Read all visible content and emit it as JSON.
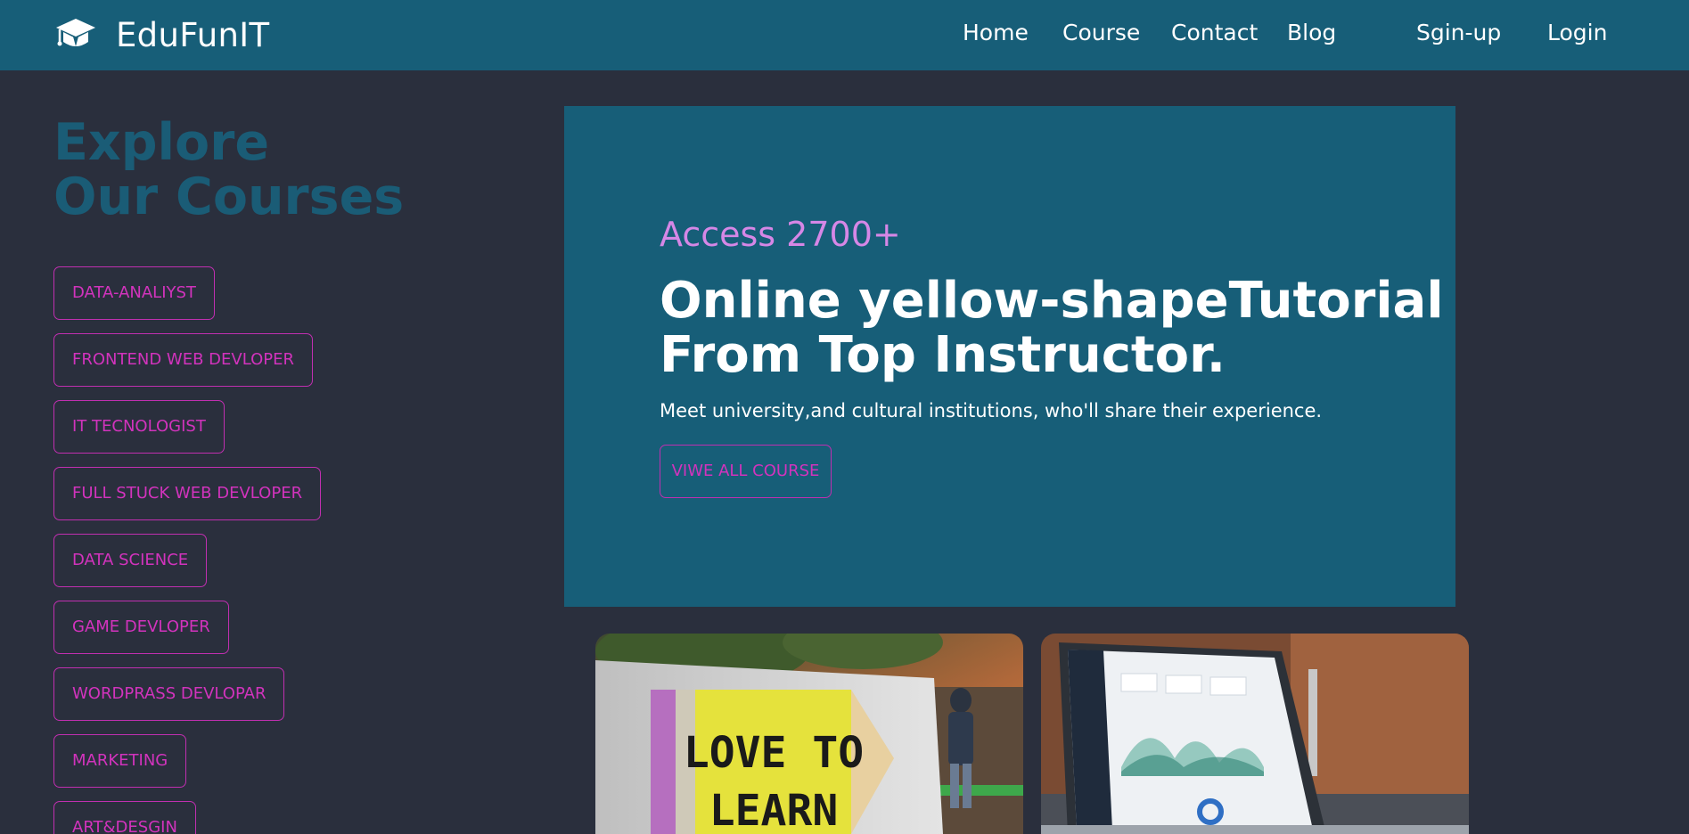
{
  "navbar": {
    "brand": "EduFunIT",
    "links": [
      "Home",
      "Course",
      "Contact",
      "Blog"
    ],
    "signup": "Sgin-up",
    "login": "Login"
  },
  "sidebar": {
    "title_line1": "Explore",
    "title_line2": "Our Courses",
    "courses": [
      "DATA-ANALIYST",
      "FRONTEND WEB DEVLOPER",
      "IT TECNOLOGIST",
      "FULL STUCK WEB DEVLOPER",
      "DATA SCIENCE",
      "GAME DEVLOPER",
      "WORDPRASS DEVLOPAR",
      "MARKETING",
      "ART&DESGIN"
    ]
  },
  "hero": {
    "access": "Access 2700+",
    "title_line1": "Online yellow-shapeTutorial",
    "title_line2": "From Top Instructor.",
    "subtitle": "Meet university,and cultural institutions, who'll share their experience.",
    "button": "VIWE ALL COURSE"
  },
  "cards": {
    "card1_text_line1": "LOVE TO",
    "card1_text_line2": "LEARN"
  },
  "colors": {
    "page_bg": "#2a2f3d",
    "navbar_bg": "#175e78",
    "accent_pink": "#d233bd",
    "title_teal": "#1a5c76",
    "access_violet": "#d687e6"
  },
  "icons": {
    "brand": "graduation-cap-icon"
  }
}
